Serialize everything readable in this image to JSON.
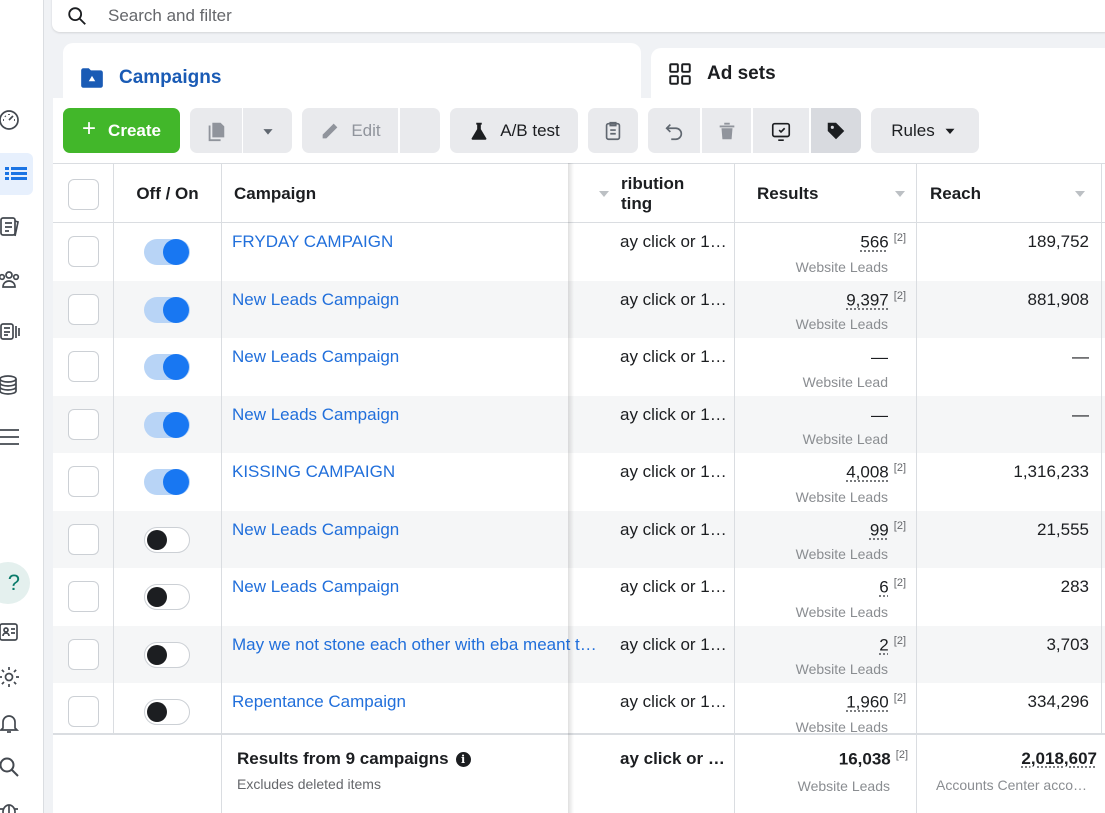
{
  "search": {
    "placeholder": "Search and filter"
  },
  "tabs": [
    {
      "label": "Campaigns",
      "icon": "folder-icon",
      "active": true
    },
    {
      "label": "Ad sets",
      "icon": "grid-icon",
      "active": false
    }
  ],
  "toolbar": {
    "create_label": "Create",
    "edit_label": "Edit",
    "ab_test_label": "A/B test",
    "rules_label": "Rules"
  },
  "columns": {
    "off_on": "Off / On",
    "campaign": "Campaign",
    "attribution_line1": "ribution",
    "attribution_line2": "ting",
    "results": "Results",
    "reach": "Reach"
  },
  "rows": [
    {
      "name": "FRYDAY CAMPAIGN",
      "on": true,
      "attribution": "ay click or 1…",
      "results": "566",
      "results_badge": "[2]",
      "results_type": "Website Leads",
      "reach": "189,752"
    },
    {
      "name": "New Leads Campaign",
      "on": true,
      "attribution": "ay click or 1…",
      "results": "9,397",
      "results_badge": "[2]",
      "results_type": "Website Leads",
      "reach": "881,908"
    },
    {
      "name": "New Leads Campaign",
      "on": true,
      "attribution": "ay click or 1…",
      "results": "—",
      "results_badge": "",
      "results_type": "Website Lead",
      "reach": "—"
    },
    {
      "name": "New Leads Campaign",
      "on": true,
      "attribution": "ay click or 1…",
      "results": "—",
      "results_badge": "",
      "results_type": "Website Lead",
      "reach": "—"
    },
    {
      "name": "KISSING CAMPAIGN",
      "on": true,
      "attribution": "ay click or 1…",
      "results": "4,008",
      "results_badge": "[2]",
      "results_type": "Website Leads",
      "reach": "1,316,233"
    },
    {
      "name": "New Leads Campaign",
      "on": false,
      "attribution": "ay click or 1…",
      "results": "99",
      "results_badge": "[2]",
      "results_type": "Website Leads",
      "reach": "21,555"
    },
    {
      "name": "New Leads Campaign",
      "on": false,
      "attribution": "ay click or 1…",
      "results": "6",
      "results_badge": "[2]",
      "results_type": "Website Leads",
      "reach": "283"
    },
    {
      "name": "May we not stone each other with eba meant t…",
      "on": false,
      "attribution": "ay click or 1…",
      "results": "2",
      "results_badge": "[2]",
      "results_type": "Website Leads",
      "reach": "3,703"
    },
    {
      "name": "Repentance Campaign",
      "on": false,
      "attribution": "ay click or 1…",
      "results": "1,960",
      "results_badge": "[2]",
      "results_type": "Website Leads",
      "reach": "334,296"
    }
  ],
  "footer": {
    "title": "Results from 9 campaigns",
    "info_glyph": "i",
    "subtitle": "Excludes deleted items",
    "attribution": "ay click or …",
    "results": "16,038",
    "results_badge": "[2]",
    "results_type": "Website Leads",
    "reach": "2,018,607",
    "reach_type": "Accounts Center acco…"
  },
  "colors": {
    "accent_blue": "#1877f2",
    "link_blue": "#216fdb",
    "create_green": "#42b72a"
  },
  "rail_icons": [
    "dashboard-icon",
    "campaigns-table-icon",
    "pages-icon",
    "audiences-icon",
    "ads-library-icon",
    "billing-icon",
    "menu-icon",
    "help-icon",
    "id-card-icon",
    "settings-icon",
    "notifications-icon",
    "search-icon",
    "bug-icon"
  ]
}
